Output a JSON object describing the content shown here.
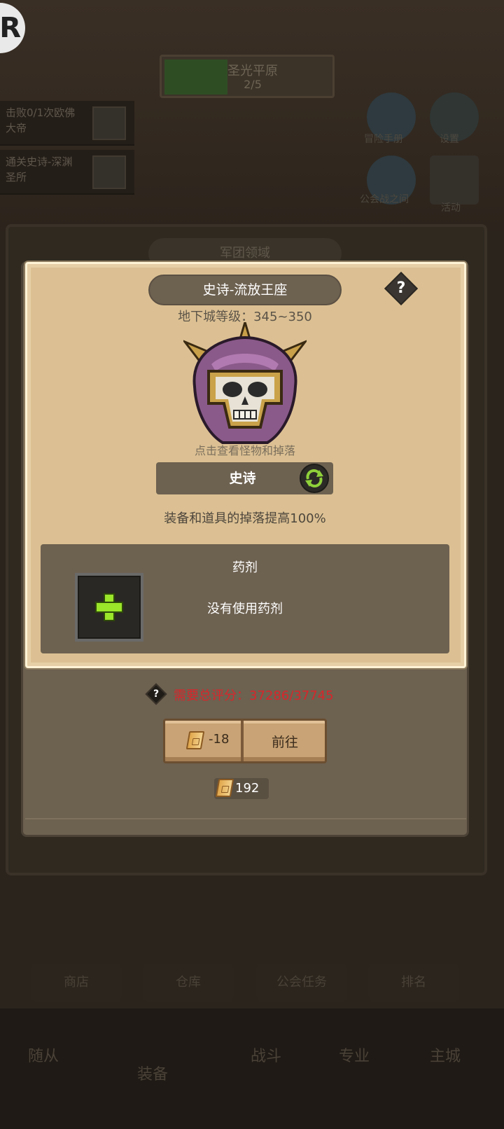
{
  "background": {
    "logo_letter": "R",
    "banner_title": "圣光平原",
    "banner_progress": "2/5",
    "quests": [
      "击败0/1次欧佛大帝",
      "通关史诗-深渊圣所"
    ],
    "side_icons": [
      "冒险手册",
      "设置",
      "公会战之间",
      "活动"
    ],
    "panel_title": "军团领域",
    "bottom_buttons": [
      "商店",
      "仓库",
      "公会任务",
      "排名"
    ],
    "tabs": [
      "随从",
      "装备",
      "战斗",
      "专业",
      "主城"
    ]
  },
  "dialog": {
    "title": "史诗-流放王座",
    "help_label": "?",
    "dungeon_level": "地下城等级：345~350",
    "view_hint": "点击查看怪物和掉落",
    "difficulty": "史诗",
    "drop_bonus": "装备和道具的掉落提高100%",
    "potion": {
      "title": "药剂",
      "empty_text": "没有使用药剂"
    },
    "requirement_help": "?",
    "requirement": "需要总评分：37286/37745",
    "go_cost": "-18",
    "go_label": "前往",
    "ticket_stock": "192"
  },
  "colors": {
    "frame": "#6d6150",
    "parchment": "#dcc093",
    "requirement_red": "#d8262b",
    "plus_green": "#9be52a"
  }
}
